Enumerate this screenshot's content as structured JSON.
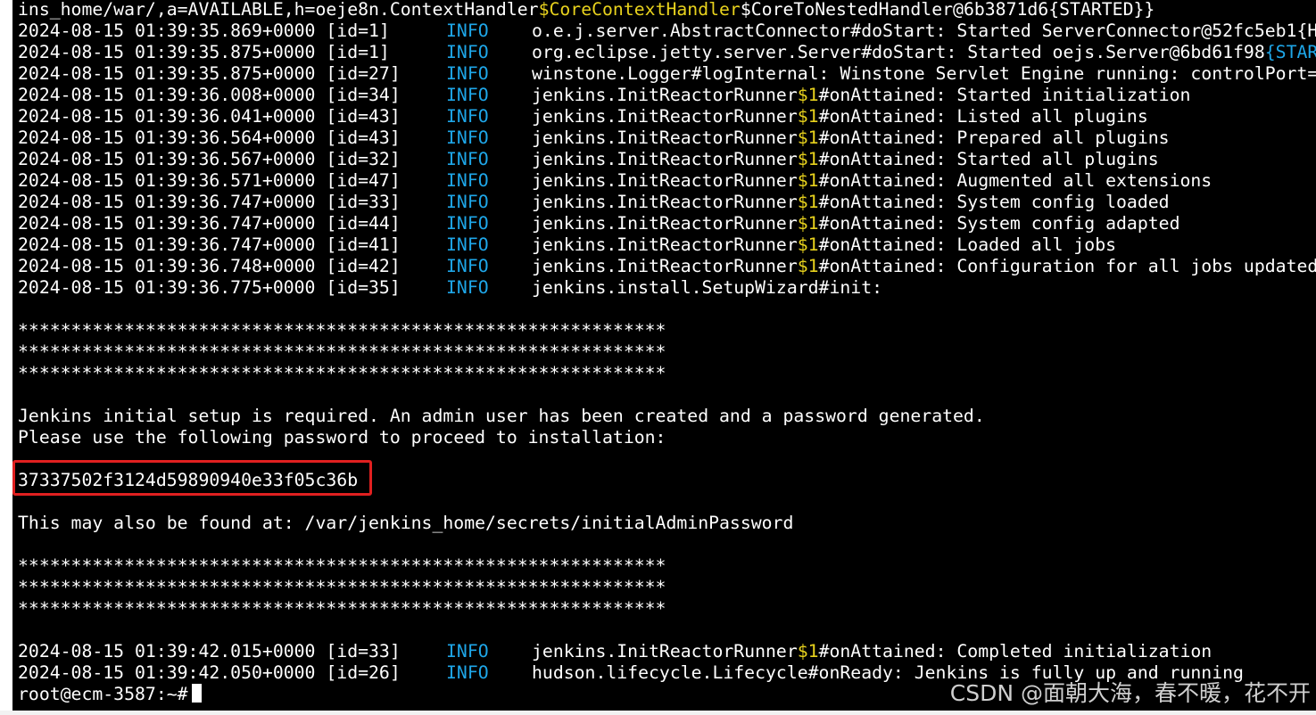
{
  "top_line": {
    "prefix": "ins_home/war/,a=AVAILABLE,h=oeje8n.ContextHandler",
    "yellow": "$CoreContextHandler",
    "suffix": "$CoreToNestedHandler@6b3871d6{STARTED}}"
  },
  "log_lines": [
    {
      "ts": "2024-08-15 01:39:35.869+0000 [id=1]",
      "level": "INFO",
      "msg": "o.e.j.server.AbstractConnector#doStart: Started ServerConnector@52fc5eb1{H"
    },
    {
      "ts": "2024-08-15 01:39:35.875+0000 [id=1]",
      "level": "INFO",
      "msg_pre": "org.eclipse.jetty.server.Server#doStart: Started oejs.Server@6bd61f98",
      "msg_cyan": "{STAR"
    },
    {
      "ts": "2024-08-15 01:39:35.875+0000 [id=27]",
      "level": "INFO",
      "msg": "winstone.Logger#logInternal: Winstone Servlet Engine running: controlPort="
    },
    {
      "ts": "2024-08-15 01:39:36.008+0000 [id=34]",
      "level": "INFO",
      "cls": "jenkins.InitReactorRunner",
      "tok": "$1",
      "rest": "#onAttained: Started initialization"
    },
    {
      "ts": "2024-08-15 01:39:36.041+0000 [id=43]",
      "level": "INFO",
      "cls": "jenkins.InitReactorRunner",
      "tok": "$1",
      "rest": "#onAttained: Listed all plugins"
    },
    {
      "ts": "2024-08-15 01:39:36.564+0000 [id=43]",
      "level": "INFO",
      "cls": "jenkins.InitReactorRunner",
      "tok": "$1",
      "rest": "#onAttained: Prepared all plugins"
    },
    {
      "ts": "2024-08-15 01:39:36.567+0000 [id=32]",
      "level": "INFO",
      "cls": "jenkins.InitReactorRunner",
      "tok": "$1",
      "rest": "#onAttained: Started all plugins"
    },
    {
      "ts": "2024-08-15 01:39:36.571+0000 [id=47]",
      "level": "INFO",
      "cls": "jenkins.InitReactorRunner",
      "tok": "$1",
      "rest": "#onAttained: Augmented all extensions"
    },
    {
      "ts": "2024-08-15 01:39:36.747+0000 [id=33]",
      "level": "INFO",
      "cls": "jenkins.InitReactorRunner",
      "tok": "$1",
      "rest": "#onAttained: System config loaded"
    },
    {
      "ts": "2024-08-15 01:39:36.747+0000 [id=44]",
      "level": "INFO",
      "cls": "jenkins.InitReactorRunner",
      "tok": "$1",
      "rest": "#onAttained: System config adapted"
    },
    {
      "ts": "2024-08-15 01:39:36.747+0000 [id=41]",
      "level": "INFO",
      "cls": "jenkins.InitReactorRunner",
      "tok": "$1",
      "rest": "#onAttained: Loaded all jobs"
    },
    {
      "ts": "2024-08-15 01:39:36.748+0000 [id=42]",
      "level": "INFO",
      "cls": "jenkins.InitReactorRunner",
      "tok": "$1",
      "rest": "#onAttained: Configuration for all jobs updated"
    },
    {
      "ts": "2024-08-15 01:39:36.775+0000 [id=35]",
      "level": "INFO",
      "msg": "jenkins.install.SetupWizard#init:"
    }
  ],
  "stars": "*************************************************************",
  "setup_msg_1": "Jenkins initial setup is required. An admin user has been created and a password generated.",
  "setup_msg_2": "Please use the following password to proceed to installation:",
  "password": "37337502f3124d59890940e33f05c36b",
  "found_at": "This may also be found at: /var/jenkins_home/secrets/initialAdminPassword",
  "final_lines": [
    {
      "ts": "2024-08-15 01:39:42.015+0000 [id=33]",
      "level": "INFO",
      "cls": "jenkins.InitReactorRunner",
      "tok": "$1",
      "rest": "#onAttained: Completed initialization"
    },
    {
      "ts": "2024-08-15 01:39:42.050+0000 [id=26]",
      "level": "INFO",
      "msg": "hudson.lifecycle.Lifecycle#onReady: Jenkins is fully up and running"
    }
  ],
  "prompt": "root@ecm-3587:~#",
  "watermark": "CSDN @面朝大海，春不暖，花不开",
  "colors": {
    "background": "#000000",
    "text": "#ffffff",
    "info": "#1ea6e8",
    "highlight_token": "#e8d21d",
    "annotation_box": "#e02020"
  }
}
